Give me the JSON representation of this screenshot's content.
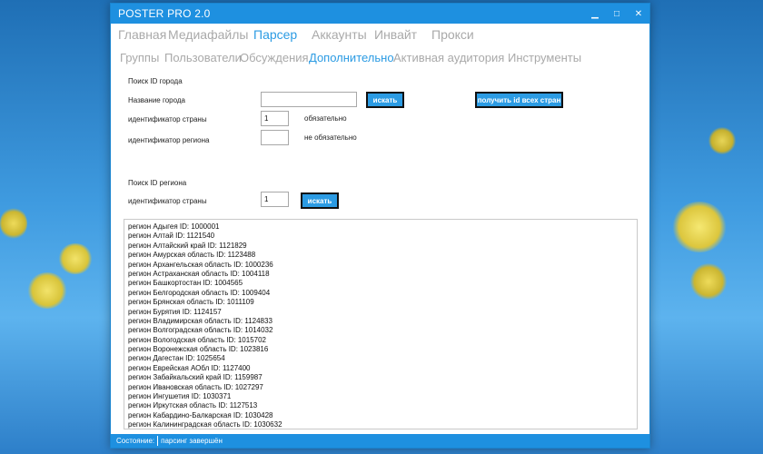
{
  "window": {
    "title": "POSTER PRO 2.0",
    "controls": {
      "minimize": "▁",
      "maximize": "□",
      "close": "✕"
    }
  },
  "menu_top": [
    "Главная",
    "Медиафайлы",
    "Парсер",
    "Аккаунты",
    "Инвайт",
    "Прокси"
  ],
  "menu_top_active": 2,
  "menu_sub": [
    "Группы",
    "Пользователи",
    "Обсуждения",
    "Дополнительно",
    "Активная аудитория",
    "Инструменты"
  ],
  "menu_sub_active": 3,
  "city_search": {
    "heading": "Поиск ID города",
    "city_name_label": "Название города",
    "city_name_value": "",
    "search_button": "искать",
    "all_countries_button": "получить id всех стран",
    "country_id_label": "идентификатор страны",
    "country_id_value": "1",
    "country_required_note": "обязательно",
    "region_id_label": "идентификатор региона",
    "region_id_value": "",
    "region_optional_note": "не обязательно"
  },
  "region_search": {
    "heading": "Поиск ID региона",
    "country_id_label": "идентификатор страны",
    "country_id_value": "1",
    "search_button": "искать"
  },
  "output_lines": [
    "регион Адыгея ID: 1000001",
    "регион Алтай ID: 1121540",
    "регион Алтайский край ID: 1121829",
    "регион Амурская область ID: 1123488",
    "регион Архангельская область ID: 1000236",
    "регион Астраханская область ID: 1004118",
    "регион Башкортостан ID: 1004565",
    "регион Белгородская область ID: 1009404",
    "регион Брянская область ID: 1011109",
    "регион Бурятия ID: 1124157",
    "регион Владимирская область ID: 1124833",
    "регион Волгоградская область ID: 1014032",
    "регион Вологодская область ID: 1015702",
    "регион Воронежская область ID: 1023816",
    "регион Дагестан ID: 1025654",
    "регион Еврейская АОбл ID: 1127400",
    "регион Забайкальский край ID: 1159987",
    "регион Ивановская область ID: 1027297",
    "регион Ингушетия ID: 1030371",
    "регион Иркутская область ID: 1127513",
    "регион Кабардино-Балкарская ID: 1030428",
    "регион Калининградская область ID: 1030632"
  ],
  "status": {
    "label": "Состояние:",
    "value": "парсинг завершён"
  }
}
